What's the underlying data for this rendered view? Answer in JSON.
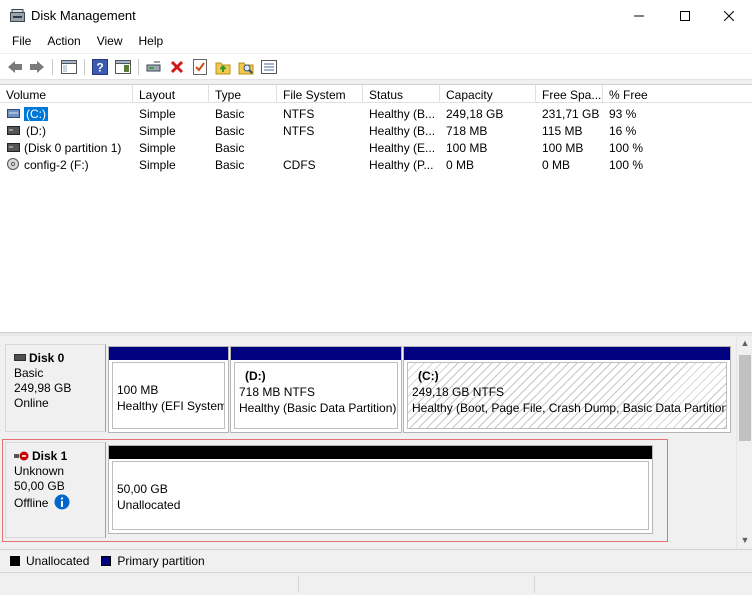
{
  "window": {
    "title": "Disk Management",
    "minimize_glyph": "—",
    "maximize_glyph": "☐",
    "close_glyph": "✕"
  },
  "menu": [
    "File",
    "Action",
    "View",
    "Help"
  ],
  "toolbar": {
    "icons": [
      "back-arrow-icon",
      "forward-arrow-icon",
      "console-tree-icon",
      "help-icon",
      "show-hide-icon",
      "connect-disk-icon",
      "delete-icon",
      "properties-check-icon",
      "open-folder-up-icon",
      "search-folder-icon",
      "list-view-icon"
    ]
  },
  "volume_list": {
    "columns": [
      "Volume",
      "Layout",
      "Type",
      "File System",
      "Status",
      "Capacity",
      "Free Spa...",
      "% Free"
    ],
    "rows": [
      {
        "volume": "(C:)",
        "layout": "Simple",
        "type": "Basic",
        "fs": "NTFS",
        "status": "Healthy (B...",
        "capacity": "249,18 GB",
        "free": "231,71 GB",
        "pct": "93 %",
        "icon": "volume-icon"
      },
      {
        "volume": "(D:)",
        "layout": "Simple",
        "type": "Basic",
        "fs": "NTFS",
        "status": "Healthy (B...",
        "capacity": "718 MB",
        "free": "115 MB",
        "pct": "16 %",
        "icon": "volume-icon"
      },
      {
        "volume": "(Disk 0 partition 1)",
        "layout": "Simple",
        "type": "Basic",
        "fs": "",
        "status": "Healthy (E...",
        "capacity": "100 MB",
        "free": "100 MB",
        "pct": "100 %",
        "icon": "volume-icon"
      },
      {
        "volume": "config-2 (F:)",
        "layout": "Simple",
        "type": "Basic",
        "fs": "CDFS",
        "status": "Healthy (P...",
        "capacity": "0 MB",
        "free": "0 MB",
        "pct": "100 %",
        "icon": "cd-drive-icon"
      }
    ]
  },
  "disks": [
    {
      "name": "Disk 0",
      "kind": "Basic",
      "size": "249,98 GB",
      "state": "Online",
      "partitions": [
        {
          "label": "",
          "size": "100 MB",
          "status": "Healthy (EFI System"
        },
        {
          "label": "(D:)",
          "size": "718 MB NTFS",
          "status": "Healthy (Basic Data Partition)"
        },
        {
          "label": "(C:)",
          "size": "249,18 GB NTFS",
          "status": "Healthy (Boot, Page File, Crash Dump, Basic Data Partition)"
        }
      ]
    },
    {
      "name": "Disk 1",
      "kind": "Unknown",
      "size": "50,00 GB",
      "state": "Offline",
      "partitions": [
        {
          "label": "",
          "size": "50,00 GB",
          "status": "Unallocated"
        }
      ]
    }
  ],
  "legend": [
    {
      "label": "Unallocated",
      "color": "#000000"
    },
    {
      "label": "Primary partition",
      "color": "#000080"
    }
  ],
  "colors": {
    "primary_bar": "#000080",
    "unallocated_bar": "#000000",
    "selection": "#0078d7",
    "disk_error": "#c40000",
    "info": "#0066cc"
  }
}
